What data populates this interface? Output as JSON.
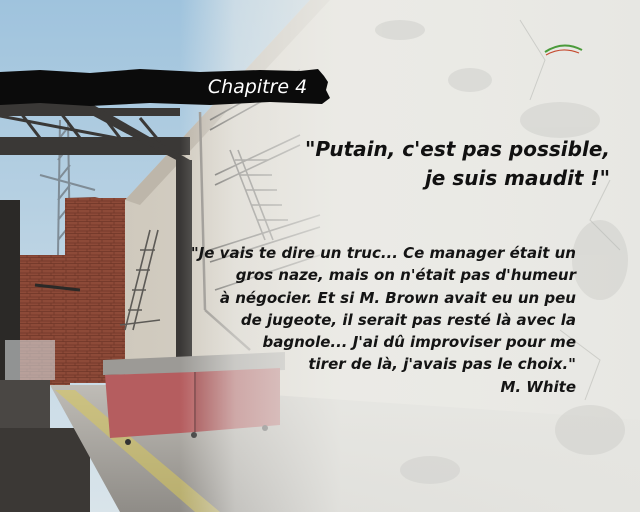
{
  "chapter": {
    "title": "Chapitre 4"
  },
  "quote": {
    "lines": [
      "\"Putain, c'est pas possible,",
      "je suis maudit !\""
    ]
  },
  "story": {
    "lines": [
      "\"Je vais te dire un truc... Ce manager était un",
      "gros naze, mais on n'était pas d'humeur",
      "à négocier. Et si M. Brown avait eu un peu",
      "de jugeote, il serait pas resté là avec la",
      "bagnole... J'ai dû improviser pour me",
      "tirer de là, j'avais pas le choix.\""
    ],
    "author": "M. White"
  },
  "colors": {
    "banner": "#0b0b0b",
    "paper": "#e9e9e6",
    "sky": "#a9c9de",
    "brick": "#8e4b3a",
    "dumpster": "#b45a5c"
  }
}
